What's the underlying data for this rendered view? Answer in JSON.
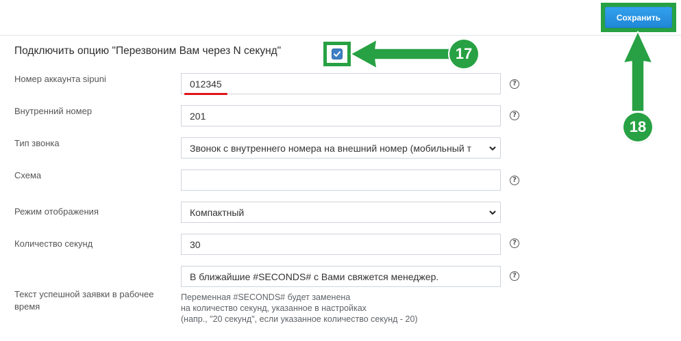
{
  "toolbar": {
    "save_label": "Сохранить"
  },
  "section": {
    "title": "Подключить опцию \"Перезвоним Вам через N секунд\"",
    "enabled": true
  },
  "form": {
    "fields": [
      {
        "label": "Номер аккаунта sipuni",
        "value": "012345"
      },
      {
        "label": "Внутренний номер",
        "value": "201"
      },
      {
        "label": "Тип звонка",
        "value": "Звонок с внутреннего номера на внешний номер (мобильный т"
      },
      {
        "label": "Схема",
        "value": ""
      },
      {
        "label": "Режим отображения",
        "value": "Компактный"
      },
      {
        "label": "Количество секунд",
        "value": "30"
      },
      {
        "label_lines": [
          "Текст успешной заявки в рабочее",
          "время"
        ],
        "value": "В ближайшие #SECONDS# с Вами свяжется менеджер."
      }
    ],
    "hint_lines": [
      "Переменная #SECONDS# будет заменена",
      "на количество секунд, указанное в настройках",
      "(напр., \"20 секунд\", если указанное количество секунд - 20)"
    ],
    "help_symbol": "?"
  },
  "annotations": {
    "step_checkbox": "17",
    "step_save": "18",
    "color": "#27a143"
  }
}
